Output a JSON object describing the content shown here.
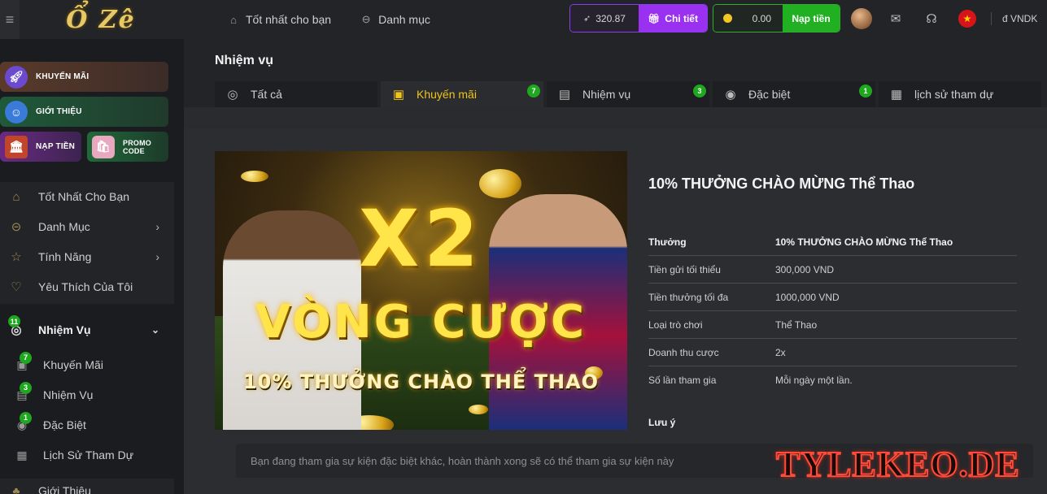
{
  "header": {
    "logo_text": "Ổ Zê",
    "nav": [
      {
        "label": "Tốt nhất cho bạn",
        "icon": "home-icon"
      },
      {
        "label": "Danh mục",
        "icon": "dots-circle-icon"
      }
    ],
    "balance": {
      "value": "320.87",
      "button": "Chi tiết"
    },
    "coins": {
      "value": "0.00",
      "button": "Nạp tiền"
    },
    "currency": "đ VNDK"
  },
  "sidebar": {
    "promos": [
      {
        "label": "KHUYẾN MÃI"
      },
      {
        "label": "GIỚI THIỆU"
      },
      {
        "label": "NẠP TIỀN"
      },
      {
        "label_line1": "PROMO",
        "label_line2": "CODE"
      }
    ],
    "menu": [
      {
        "label": "Tốt Nhất Cho Bạn"
      },
      {
        "label": "Danh Mục"
      },
      {
        "label": "Tính Năng"
      },
      {
        "label": "Yêu Thích Của Tôi"
      }
    ],
    "tasks": {
      "label": "Nhiệm Vụ",
      "badge": "11",
      "items": [
        {
          "label": "Khuyến Mãi",
          "badge": "7"
        },
        {
          "label": "Nhiệm Vụ",
          "badge": "3"
        },
        {
          "label": "Đặc Biệt",
          "badge": "1"
        },
        {
          "label": "Lịch Sử Tham Dự"
        }
      ]
    },
    "bottom": {
      "label": "Giới Thiệu"
    }
  },
  "main": {
    "title": "Nhiệm vụ",
    "tabs": [
      {
        "label": "Tất cả"
      },
      {
        "label": "Khuyến mãi",
        "count": "7"
      },
      {
        "label": "Nhiệm vụ",
        "count": "3"
      },
      {
        "label": "Đặc biệt",
        "count": "1"
      },
      {
        "label": "lịch sử tham dự"
      }
    ],
    "banner": {
      "headline": "X2",
      "line2": "VÒNG CƯỢC",
      "line3": "10% THƯỞNG CHÀO THỂ THAO"
    },
    "promo": {
      "title": "10% THƯỞNG CHÀO MỪNG Thể Thao",
      "rows": [
        {
          "k": "Thưởng",
          "v": "10% THƯỞNG CHÀO MỪNG Thể Thao"
        },
        {
          "k": "Tiền gửi tối thiểu",
          "v": "300,000 VND"
        },
        {
          "k": "Tiền thưởng tối đa",
          "v": "1000,000 VND"
        },
        {
          "k": "Loại trò chơi",
          "v": "Thể Thao"
        },
        {
          "k": "Doanh thu cược",
          "v": "2x"
        },
        {
          "k": "Số lần tham gia",
          "v": "Mỗi ngày một lần."
        }
      ],
      "note_label": "Lưu ý"
    },
    "notice": "Bạn đang tham gia sự kiện đặc biệt khác, hoàn thành xong sẽ có thể tham gia sự kiện này"
  },
  "watermark": "TYLEKEO.DE",
  "colors": {
    "accent_purple": "#9a31f0",
    "accent_green": "#21b021",
    "active_tab": "#f0c419",
    "badge_green": "#1fa81f"
  }
}
